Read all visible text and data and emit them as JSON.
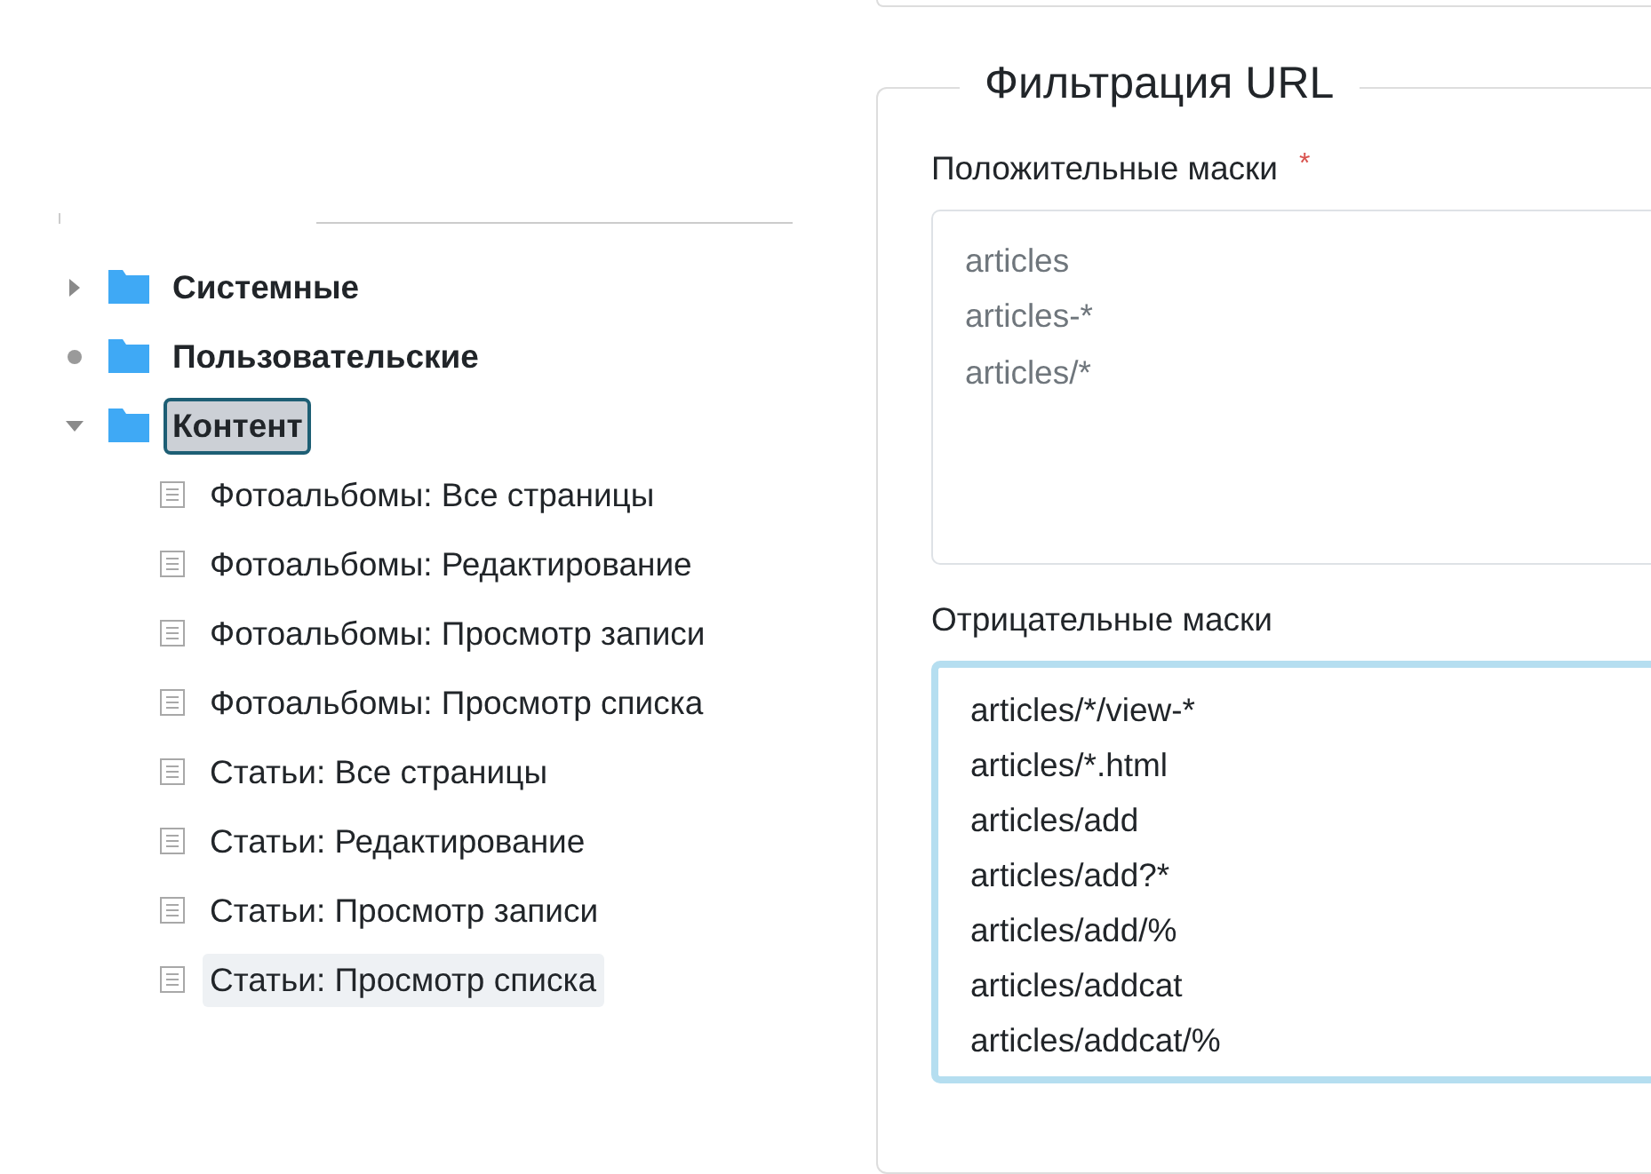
{
  "tree": [
    {
      "label": "Системные",
      "expandable": true,
      "expanded": false,
      "selected": false
    },
    {
      "label": "Пользовательские",
      "expandable": false,
      "selected": false
    },
    {
      "label": "Контент",
      "expandable": true,
      "expanded": true,
      "selected": true,
      "children": [
        {
          "label": "Фотоальбомы: Все страницы",
          "hovered": false
        },
        {
          "label": "Фотоальбомы: Редактирование",
          "hovered": false
        },
        {
          "label": "Фотоальбомы: Просмотр записи",
          "hovered": false
        },
        {
          "label": "Фотоальбомы: Просмотр списка",
          "hovered": false
        },
        {
          "label": "Статьи: Все страницы",
          "hovered": false
        },
        {
          "label": "Статьи: Редактирование",
          "hovered": false
        },
        {
          "label": "Статьи: Просмотр записи",
          "hovered": false
        },
        {
          "label": "Статьи: Просмотр списка",
          "hovered": true
        }
      ]
    }
  ],
  "url_filter": {
    "title": "Фильтрация URL",
    "fields": [
      {
        "label": "Положительные маски",
        "required_mark": "*",
        "focused": false,
        "placeholder": [
          "articles",
          "articles-*",
          "articles/*"
        ]
      },
      {
        "label": "Отрицательные маски",
        "focused": true,
        "value": [
          "articles/*/view-*",
          "articles/*.html",
          "articles/add",
          "articles/add?*",
          "articles/add/%",
          "articles/addcat",
          "articles/addcat/%"
        ]
      }
    ]
  }
}
